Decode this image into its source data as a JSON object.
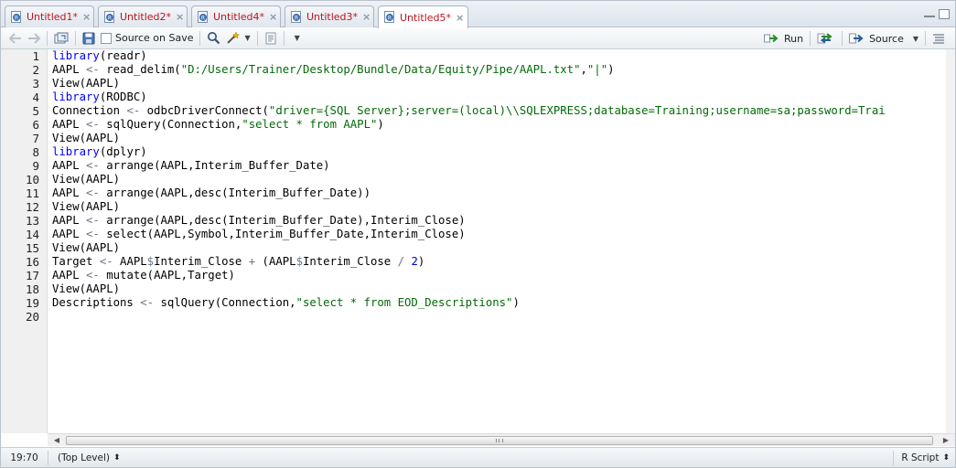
{
  "tabs": [
    {
      "label": "Untitled1*"
    },
    {
      "label": "Untitled2*"
    },
    {
      "label": "Untitled4*"
    },
    {
      "label": "Untitled3*"
    },
    {
      "label": "Untitled5*"
    }
  ],
  "toolbar": {
    "source_on_save_label": "Source on Save",
    "run_label": "Run",
    "source_label": "Source"
  },
  "editor": {
    "line_numbers": [
      "1",
      "2",
      "3",
      "4",
      "5",
      "6",
      "7",
      "8",
      "9",
      "10",
      "11",
      "12",
      "13",
      "14",
      "15",
      "16",
      "17",
      "18",
      "19",
      "20"
    ],
    "lines": [
      [
        {
          "t": "library",
          "c": "kw"
        },
        {
          "t": "(readr)"
        }
      ],
      [
        {
          "t": "AAPL "
        },
        {
          "t": "<-",
          "c": "op"
        },
        {
          "t": " read_delim("
        },
        {
          "t": "\"D:/Users/Trainer/Desktop/Bundle/Data/Equity/Pipe/AAPL.txt\"",
          "c": "str"
        },
        {
          "t": ","
        },
        {
          "t": "\"|\"",
          "c": "str"
        },
        {
          "t": ")"
        }
      ],
      [
        {
          "t": "View(AAPL)"
        }
      ],
      [
        {
          "t": "library",
          "c": "kw"
        },
        {
          "t": "(RODBC)"
        }
      ],
      [
        {
          "t": "Connection "
        },
        {
          "t": "<-",
          "c": "op"
        },
        {
          "t": " odbcDriverConnect("
        },
        {
          "t": "\"driver={SQL Server};server=(local)\\\\SQLEXPRESS;database=Training;username=sa;password=Trai",
          "c": "str"
        }
      ],
      [
        {
          "t": "AAPL "
        },
        {
          "t": "<-",
          "c": "op"
        },
        {
          "t": " sqlQuery(Connection,"
        },
        {
          "t": "\"select * from AAPL\"",
          "c": "str"
        },
        {
          "t": ")"
        }
      ],
      [
        {
          "t": "View(AAPL)"
        }
      ],
      [
        {
          "t": "library",
          "c": "kw"
        },
        {
          "t": "(dplyr)"
        }
      ],
      [
        {
          "t": "AAPL "
        },
        {
          "t": "<-",
          "c": "op"
        },
        {
          "t": " arrange(AAPL,Interim_Buffer_Date)"
        }
      ],
      [
        {
          "t": "View(AAPL)"
        }
      ],
      [
        {
          "t": "AAPL "
        },
        {
          "t": "<-",
          "c": "op"
        },
        {
          "t": " arrange(AAPL,desc(Interim_Buffer_Date))"
        }
      ],
      [
        {
          "t": "View(AAPL)"
        }
      ],
      [
        {
          "t": "AAPL "
        },
        {
          "t": "<-",
          "c": "op"
        },
        {
          "t": " arrange(AAPL,desc(Interim_Buffer_Date),Interim_Close)"
        }
      ],
      [
        {
          "t": "AAPL "
        },
        {
          "t": "<-",
          "c": "op"
        },
        {
          "t": " select(AAPL,Symbol,Interim_Buffer_Date,Interim_Close)"
        }
      ],
      [
        {
          "t": "View(AAPL)"
        }
      ],
      [
        {
          "t": "Target "
        },
        {
          "t": "<-",
          "c": "op"
        },
        {
          "t": " AAPL"
        },
        {
          "t": "$",
          "c": "op"
        },
        {
          "t": "Interim_Close "
        },
        {
          "t": "+",
          "c": "op"
        },
        {
          "t": " (AAPL"
        },
        {
          "t": "$",
          "c": "op"
        },
        {
          "t": "Interim_Close "
        },
        {
          "t": "/",
          "c": "op"
        },
        {
          "t": " "
        },
        {
          "t": "2",
          "c": "num"
        },
        {
          "t": ")"
        }
      ],
      [
        {
          "t": "AAPL "
        },
        {
          "t": "<-",
          "c": "op"
        },
        {
          "t": " mutate(AAPL,Target)"
        }
      ],
      [
        {
          "t": "View(AAPL)"
        }
      ],
      [
        {
          "t": "Descriptions "
        },
        {
          "t": "<-",
          "c": "op"
        },
        {
          "t": " sqlQuery(Connection,"
        },
        {
          "t": "\"select * from EOD_Descriptions\"",
          "c": "str"
        },
        {
          "t": ")"
        }
      ],
      []
    ]
  },
  "statusbar": {
    "cursor_position": "19:70",
    "scope": "(Top Level)",
    "file_type": "R Script"
  },
  "icons": {
    "file": "r-file-icon",
    "close": "close-icon"
  },
  "colors": {
    "tab_text": "#c0141e",
    "keyword": "#0000ff",
    "string": "#036a07",
    "run_arrow": "#2a8a2a"
  }
}
